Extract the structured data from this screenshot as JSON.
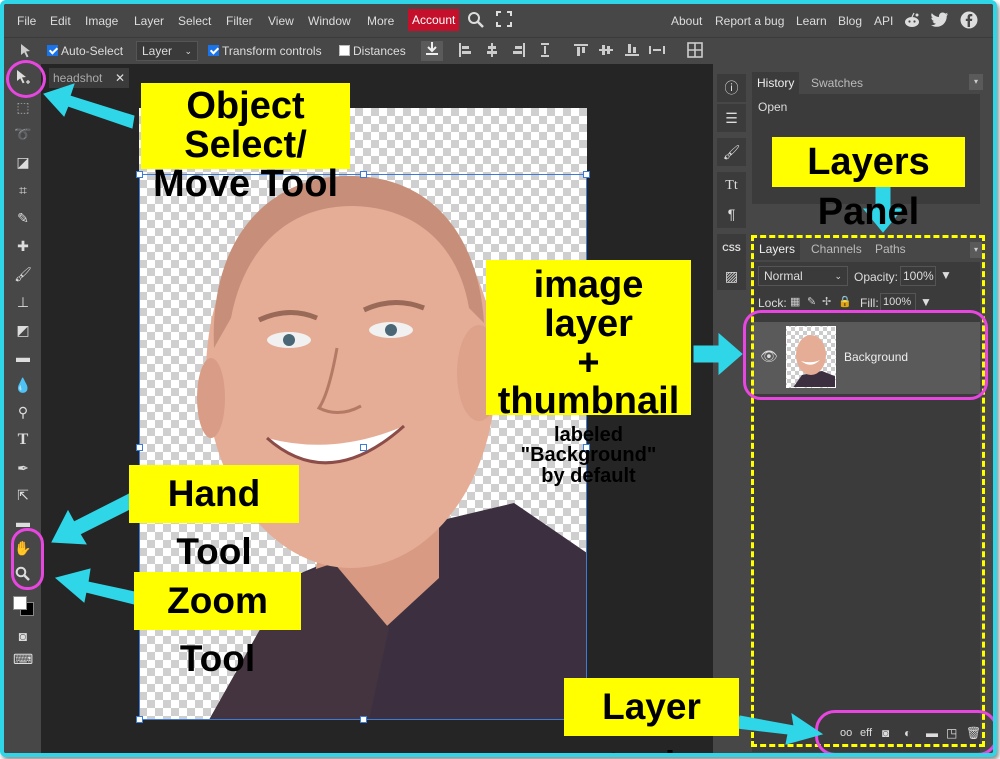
{
  "menubar": {
    "items": [
      "File",
      "Edit",
      "Image",
      "Layer",
      "Select",
      "Filter",
      "View",
      "Window",
      "More"
    ],
    "account": "Account",
    "right_links": [
      "About",
      "Report a bug",
      "Learn",
      "Blog",
      "API"
    ],
    "icons": [
      "search-icon",
      "fullscreen-icon",
      "reddit-icon",
      "twitter-icon",
      "facebook-icon"
    ]
  },
  "toolbar": {
    "auto_select": "Auto-Select",
    "layer_select": "Layer",
    "transform_controls": "Transform controls",
    "distances": "Distances",
    "auto_select_checked": true,
    "transform_controls_checked": true,
    "distances_checked": false
  },
  "document": {
    "tab_name": "headshot",
    "close_glyph": "✕"
  },
  "right_panel": {
    "top_tabs": [
      "History",
      "Swatches"
    ],
    "history_items": [
      "Open"
    ],
    "layer_tabs": [
      "Layers",
      "Channels",
      "Paths"
    ],
    "blend_mode": "Normal",
    "opacity_label": "Opacity:",
    "opacity_value": "100%",
    "lock_label": "Lock:",
    "fill_label": "Fill:",
    "fill_value": "100%",
    "layer_name": "Background",
    "layer_tool_labels": {
      "link": "oo",
      "effects": "eff"
    }
  },
  "annotations": {
    "object_select": [
      "Object Select/",
      "Move Tool"
    ],
    "layers_panel": "Layers Panel",
    "image_layer": [
      "image layer",
      "+ thumbnail"
    ],
    "image_layer_note": [
      "labeled \"Background\"",
      "by default"
    ],
    "hand_tool": "Hand Tool",
    "zoom_tool": "Zoom Tool",
    "layer_tools": "Layer tools"
  },
  "colors": {
    "annotation_bg": "#ffff00",
    "arrow": "#2fd6e8",
    "loop": "#e846e0",
    "account": "#c4102a"
  }
}
